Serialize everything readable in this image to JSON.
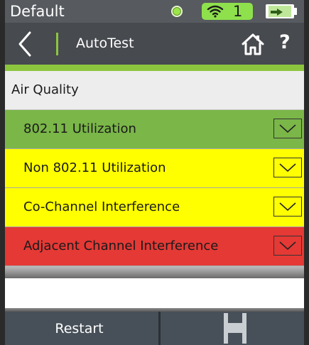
{
  "status_bar": {
    "title": "Default",
    "wifi_count": "1",
    "colors": {
      "indicator": "#9be54a",
      "wifi_badge": "#8ee04c"
    },
    "icons": [
      "status-indicator-icon",
      "wifi-icon",
      "battery-charging-icon"
    ]
  },
  "nav": {
    "title": "AutoTest",
    "help_label": "?",
    "icons": [
      "back-chevron-icon",
      "home-icon"
    ]
  },
  "section": {
    "title": "Air Quality"
  },
  "rows": [
    {
      "label": "802.11 Utilization",
      "status_color": "#7ab648"
    },
    {
      "label": "Non 802.11 Utilization",
      "status_color": "#ffff00"
    },
    {
      "label": "Co-Channel Interference",
      "status_color": "#ffff00"
    },
    {
      "label": "Adjacent Channel Interference",
      "status_color": "#e53935"
    }
  ],
  "bottom": {
    "restart_label": "Restart",
    "save_icon": "save-floppy-icon"
  }
}
